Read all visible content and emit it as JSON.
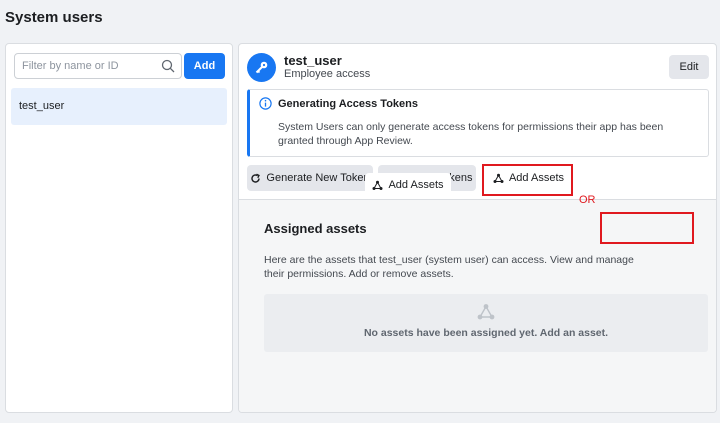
{
  "page": {
    "title": "System users"
  },
  "sidebar": {
    "filter_placeholder": "Filter by name or ID",
    "add_label": "Add",
    "users": [
      {
        "label": "test_user"
      }
    ]
  },
  "detail": {
    "user_name": "test_user",
    "user_role": "Employee access",
    "edit_label": "Edit",
    "info": {
      "title": "Generating Access Tokens",
      "body": "System Users can only generate access tokens for permissions their app has been granted through App Review."
    },
    "toolbar": {
      "generate_label": "Generate New Token",
      "revoke_label": "Revoke Tokens",
      "add_assets_label": "Add Assets"
    },
    "or_label": "OR",
    "assets": {
      "title": "Assigned assets",
      "add_label": "Add Assets",
      "description": "Here are the assets that test_user (system user) can access. View and manage their permissions. Add or remove assets.",
      "empty_text": "No assets have been assigned yet. Add an asset."
    }
  },
  "colors": {
    "accent": "#1877f2",
    "highlight": "#e0191f",
    "selected_row": "#e7f0fd"
  },
  "icons": [
    "search-icon",
    "key-icon",
    "info-icon",
    "refresh-icon",
    "revoke-icon",
    "assets-icon"
  ]
}
